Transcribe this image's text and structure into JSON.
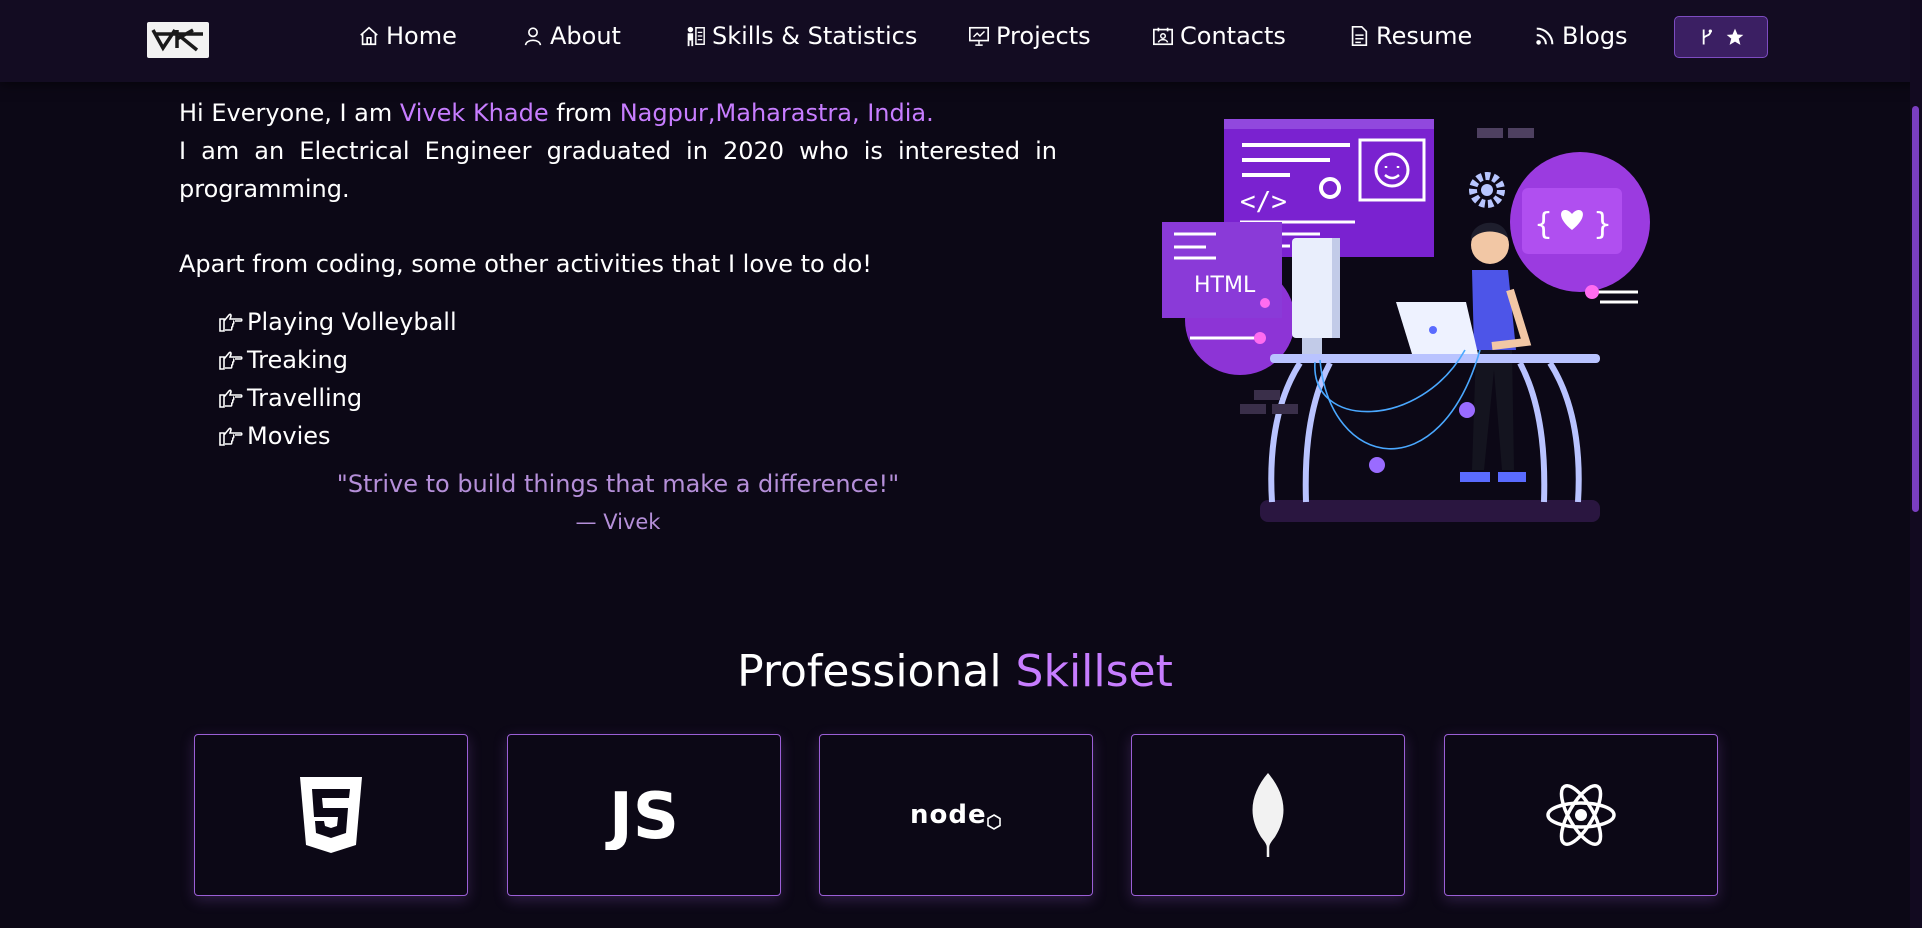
{
  "nav": {
    "logo_alt": "VK logo",
    "items": [
      {
        "label": "Home",
        "icon": "home-icon"
      },
      {
        "label": "About",
        "icon": "user-icon"
      },
      {
        "label": "Skills & Statistics",
        "icon": "skills-icon"
      },
      {
        "label": "Projects",
        "icon": "presentation-icon"
      },
      {
        "label": "Contacts",
        "icon": "contact-card-icon"
      },
      {
        "label": "Resume",
        "icon": "document-icon"
      },
      {
        "label": "Blogs",
        "icon": "rss-feed-icon"
      }
    ],
    "github_button": {
      "icons": [
        "git-fork-icon",
        "star-icon"
      ]
    }
  },
  "intro": {
    "greeting_pre": "Hi Everyone, I am ",
    "name": "Vivek Khade",
    "greeting_mid": " from ",
    "location": "Nagpur,Maharastra, India.",
    "line2": "I am an Electrical Engineer graduated in 2020 who is interested in programming.",
    "activities_intro": "Apart from coding, some other activities that I love to do!",
    "hobbies": [
      "Playing Volleyball",
      "Treaking",
      "Travelling",
      "Movies"
    ]
  },
  "quote": {
    "text": "\"Strive to build things that make a difference!\"",
    "author": "— Vivek"
  },
  "illustration": {
    "html_label": "HTML"
  },
  "skills": {
    "title_pre": "Professional ",
    "title_accent": "Skillset",
    "cards": [
      {
        "name": "HTML5",
        "icon": "html5-icon"
      },
      {
        "name": "JavaScript",
        "icon": "javascript-icon",
        "label": "JS"
      },
      {
        "name": "Node.js",
        "icon": "nodejs-icon",
        "label": "node"
      },
      {
        "name": "MongoDB",
        "icon": "mongodb-leaf-icon"
      },
      {
        "name": "React",
        "icon": "react-icon"
      }
    ]
  },
  "colors": {
    "background": "#0c0816",
    "navbar": "#130c22",
    "accent": "#c77dff",
    "quote": "#b58fd9",
    "card_border": "#9b5fd6"
  }
}
